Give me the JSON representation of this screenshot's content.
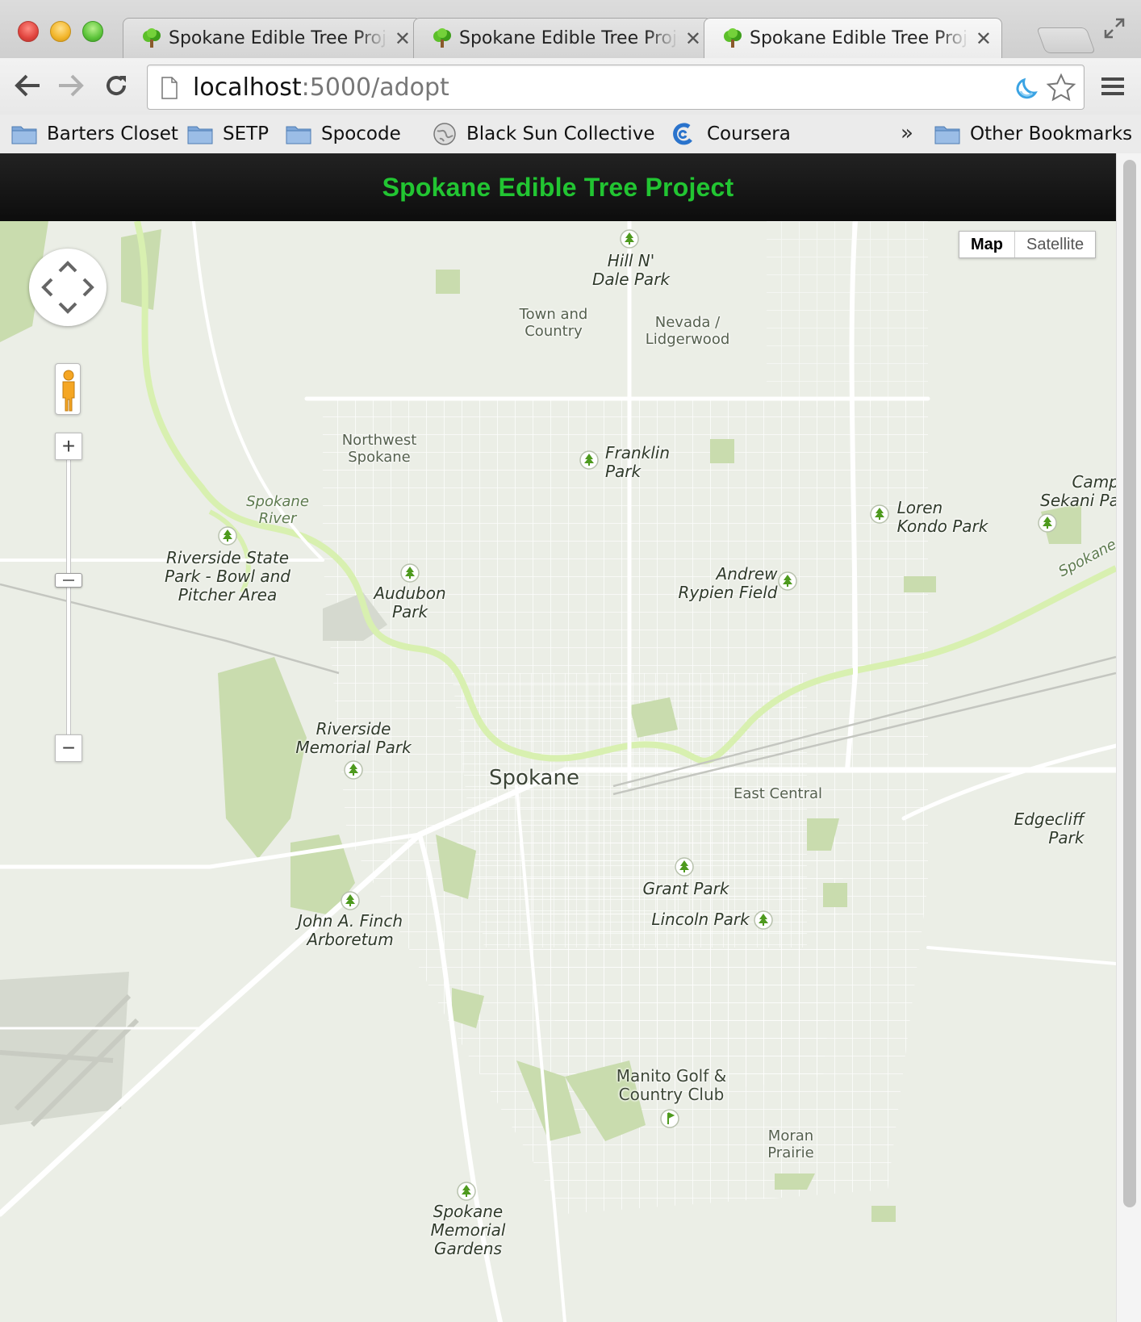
{
  "browser": {
    "tabs": [
      {
        "title": "Spokane Edible Tree Project",
        "active": false
      },
      {
        "title": "Spokane Edible Tree Project",
        "active": false
      },
      {
        "title": "Spokane Edible Tree Project",
        "active": true
      }
    ],
    "tab_close_glyph": "✕",
    "url_host": "localhost",
    "url_rest": ":5000/adopt",
    "bookmarks": [
      {
        "label": "Barters Closet",
        "icon": "folder-icon"
      },
      {
        "label": "SETP",
        "icon": "folder-icon"
      },
      {
        "label": "Spocode",
        "icon": "folder-icon"
      },
      {
        "label": "Black Sun Collective",
        "icon": "globe-icon"
      },
      {
        "label": "Coursera",
        "icon": "coursera-icon"
      }
    ],
    "bookmarks_overflow": "»",
    "other_bookmarks": "Other Bookmarks"
  },
  "site": {
    "title": "Spokane Edible Tree Project",
    "title_color": "#22c532"
  },
  "map": {
    "type_controls": {
      "map": "Map",
      "satellite": "Satellite",
      "selected": "Map"
    },
    "zoom_in": "+",
    "zoom_out": "−",
    "city": "Spokane",
    "parks": {
      "hill_n_dale": "Hill N'\nDale Park",
      "franklin": "Franklin\nPark",
      "loren_kondo": "Loren\nKondo Park",
      "camp_sekani": "Camp\nSekani Pa",
      "andrew_rypien": "Andrew\nRypien Field",
      "audubon": "Audubon\nPark",
      "riverside_state": "Riverside State\nPark - Bowl and\nPitcher Area",
      "riverside_memorial": "Riverside\nMemorial Park",
      "edgecliff": "Edgecliff\nPark",
      "grant": "Grant Park",
      "lincoln": "Lincoln Park",
      "john_finch": "John A. Finch\nArboretum",
      "spokane_memorial": "Spokane\nMemorial\nGardens"
    },
    "neighborhoods": {
      "town_country": "Town and\nCountry",
      "nevada_lidgerwood": "Nevada /\nLidgerwood",
      "northwest_spokane": "Northwest\nSpokane",
      "east_central": "East Central",
      "manito": "Manito Golf &\nCountry Club",
      "moran_prairie": "Moran\nPrairie"
    },
    "water": {
      "spokane_river_west": "Spokane\nRiver",
      "spokane_river_east": "Spokane"
    },
    "colors": {
      "land": "#ebeee6",
      "park": "#c9dcae",
      "road": "#ffffff",
      "river": "#d8f0b0",
      "marker": "#4e9a1e"
    }
  }
}
